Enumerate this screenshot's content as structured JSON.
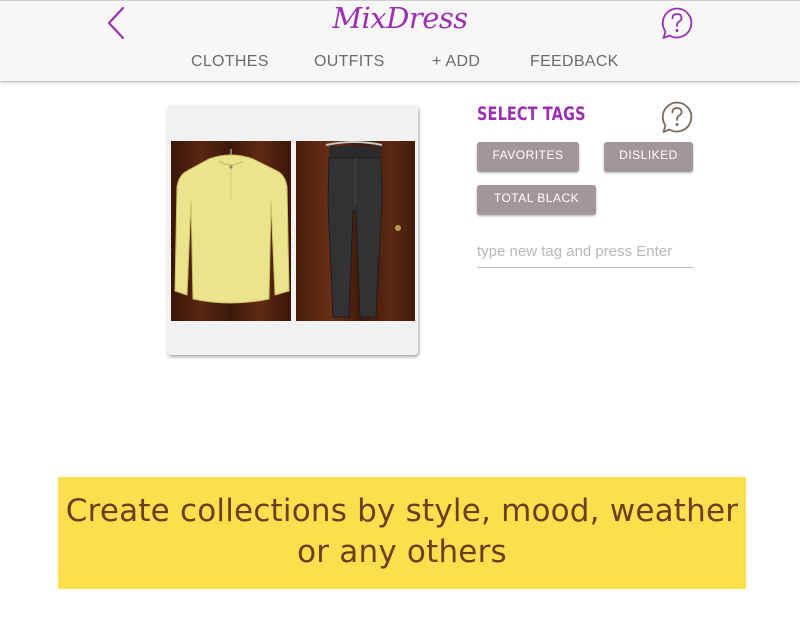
{
  "app": {
    "logo_text": "MixDress"
  },
  "nav": {
    "back_icon": "chevron-left-icon",
    "help_icon": "help-bubble-icon",
    "tabs": [
      {
        "label": "CLOTHES"
      },
      {
        "label": "OUTFITS"
      },
      {
        "label": "+ ADD"
      },
      {
        "label": "FEEDBACK"
      }
    ]
  },
  "outfit": {
    "items": [
      {
        "name": "yellow blouse",
        "color": "#eee58a"
      },
      {
        "name": "black jeans",
        "color": "#2f2f31"
      }
    ]
  },
  "tags": {
    "title": "SELECT TAGS",
    "help_icon": "help-bubble-icon",
    "items": [
      {
        "label": "FAVORITES"
      },
      {
        "label": "DISLIKED"
      },
      {
        "label": "TOTAL BLACK"
      }
    ],
    "input": {
      "value": "",
      "placeholder": "type new tag and press Enter"
    }
  },
  "banner": {
    "line1": "Create collections by style, mood, weather",
    "line2": "or any others"
  },
  "colors": {
    "accent": "#9c2fb2",
    "tag_bg": "#a3959c",
    "banner_bg": "#fddf4e",
    "banner_text": "#6b3f1e"
  }
}
